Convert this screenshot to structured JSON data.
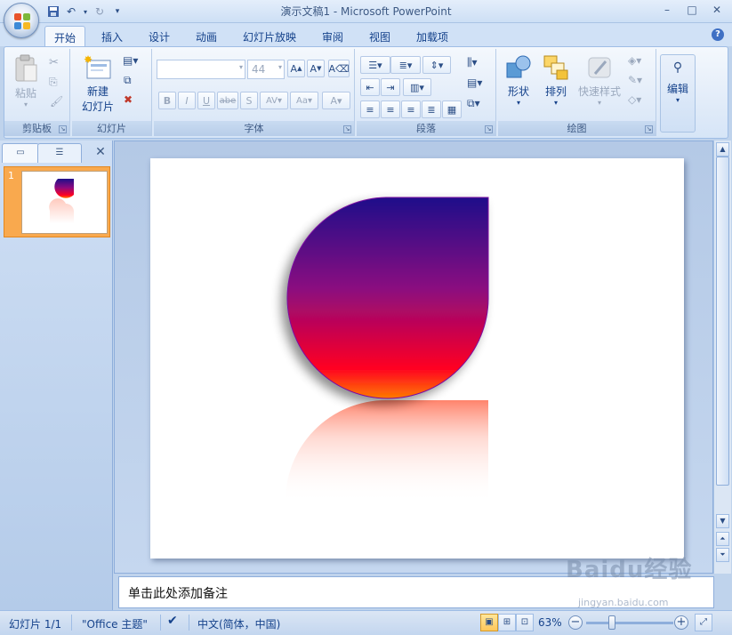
{
  "window": {
    "title": "演示文稿1 - Microsoft PowerPoint",
    "minimize": "–",
    "maximize": "□",
    "close": "✕"
  },
  "ribbon_tabs": [
    {
      "label": "开始",
      "active": true
    },
    {
      "label": "插入"
    },
    {
      "label": "设计"
    },
    {
      "label": "动画"
    },
    {
      "label": "幻灯片放映"
    },
    {
      "label": "审阅"
    },
    {
      "label": "视图"
    },
    {
      "label": "加载项"
    }
  ],
  "groups": {
    "clipboard": {
      "label": "剪贴板",
      "paste": "粘贴"
    },
    "slides": {
      "label": "幻灯片",
      "new_slide_line1": "新建",
      "new_slide_line2": "幻灯片"
    },
    "font": {
      "label": "字体",
      "font_name": "",
      "font_size": "44"
    },
    "paragraph": {
      "label": "段落"
    },
    "drawing": {
      "label": "绘图",
      "shapes": "形状",
      "arrange": "排列",
      "quick_styles": "快速样式"
    },
    "editing": {
      "label": "编辑"
    }
  },
  "slide_panel": {
    "slide_number": "1"
  },
  "notes": {
    "placeholder": "单击此处添加备注"
  },
  "statusbar": {
    "slide_info": "幻灯片 1/1",
    "theme": "\"Office 主题\"",
    "language": "中文(简体，中国)",
    "zoom": "63%"
  },
  "watermark": {
    "text": "Baidu经验",
    "sub": "jingyan.baidu.com"
  },
  "colors": {
    "shape_top": "#1e0f8a",
    "shape_mid": "#8a0a80",
    "shape_low": "#ff0022",
    "shape_bottom": "#ff7a00",
    "accent": "#15428b"
  }
}
